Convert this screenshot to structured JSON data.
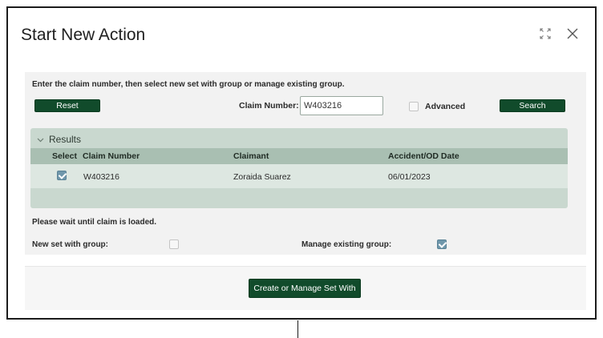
{
  "dialog": {
    "title": "Start New Action",
    "expand_icon": "expand-icon",
    "close_icon": "close-icon"
  },
  "search": {
    "instruction": "Enter the claim number, then select new set with group or manage existing group.",
    "reset_label": "Reset",
    "claim_number_label": "Claim Number:",
    "claim_number_value": "W403216",
    "advanced_label": "Advanced",
    "advanced_checked": false,
    "search_label": "Search"
  },
  "results": {
    "title": "Results",
    "columns": [
      "Select",
      "Claim Number",
      "Claimant",
      "Accident/OD Date"
    ],
    "rows": [
      {
        "selected": true,
        "claim_number": "W403216",
        "claimant": "Zoraida Suarez",
        "date": "06/01/2023"
      }
    ]
  },
  "status": {
    "message": "Please wait until claim is loaded."
  },
  "options": {
    "new_set_label": "New set with group:",
    "new_set_checked": false,
    "manage_label": "Manage existing group:",
    "manage_checked": true
  },
  "footer": {
    "create_label": "Create or Manage Set With"
  },
  "colors": {
    "primary_button": "#114b2b",
    "results_panel": "#c9d8cf",
    "grid_header": "#a9bfb2",
    "checkbox_checked": "#6f97ab"
  }
}
